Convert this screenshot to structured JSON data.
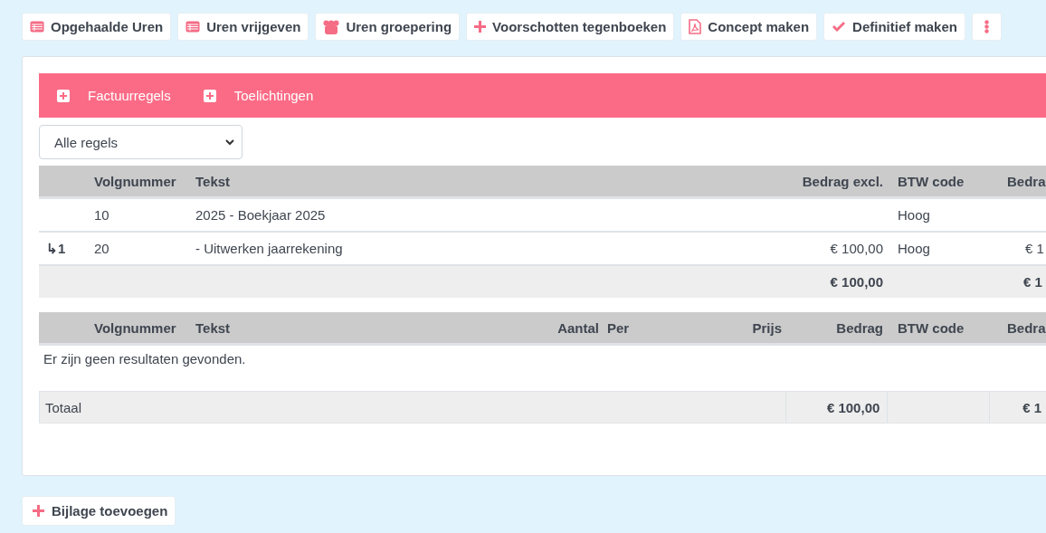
{
  "toolbar": [
    {
      "kind": "list",
      "label": "Opgehaalde Uren"
    },
    {
      "kind": "list",
      "label": "Uren vrijgeven"
    },
    {
      "kind": "group",
      "label": "Uren groepering"
    },
    {
      "kind": "plus",
      "label": "Voorschotten tegenboeken"
    },
    {
      "kind": "pdf",
      "label": "Concept maken"
    },
    {
      "kind": "check",
      "label": "Definitief maken"
    },
    {
      "kind": "more"
    }
  ],
  "sections": [
    {
      "label": "Factuurregels"
    },
    {
      "label": "Toelichtingen"
    }
  ],
  "filter": {
    "value": "Alle regels"
  },
  "lines_table": {
    "columns": [
      null,
      "Volgnummer",
      "Tekst",
      "Bedrag excl.",
      "BTW code",
      "Bedra"
    ],
    "rows": [
      {
        "cells": [
          null,
          "10",
          "2025 - Boekjaar 2025",
          null,
          "Hoog",
          null
        ]
      },
      {
        "cells": [
          "↳1",
          "20",
          "- Uitwerken jaarrekening",
          "€ 100,00",
          "Hoog",
          "€ 1"
        ]
      }
    ],
    "total": {
      "bedrag_excl": "€ 100,00",
      "column_6": "€ 1"
    }
  },
  "attachments_table": {
    "columns": [
      null,
      "Volgnummer",
      "Tekst",
      "Aantal",
      "Per",
      "Prijs",
      "Bedrag",
      "BTW code",
      "Bedra"
    ],
    "empty_message": "Er zijn geen resultaten gevonden.",
    "total": {
      "label": "Totaal",
      "bedrag": "€ 100,00",
      "column_4": "€ 1"
    }
  },
  "add_button": {
    "label": "Bijlage toevoegen"
  }
}
